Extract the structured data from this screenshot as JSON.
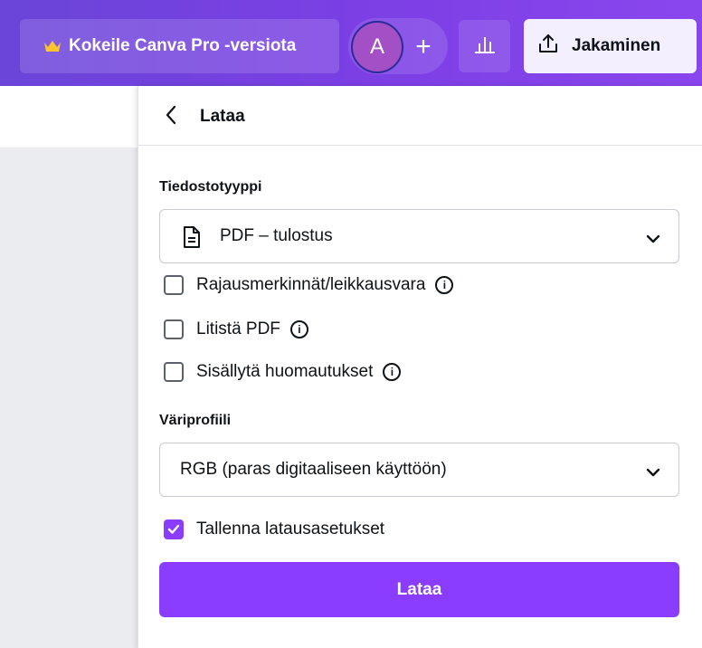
{
  "topbar": {
    "pro_label": "Kokeile Canva Pro -versiota",
    "avatar_initial": "A",
    "add_label": "+",
    "share_label": "Jakaminen"
  },
  "panel": {
    "title": "Lataa",
    "file_type_label": "Tiedostotyyppi",
    "file_type_value": "PDF – tulostus",
    "options": [
      {
        "label": "Rajausmerkinnät/leikkausvara",
        "checked": false
      },
      {
        "label": "Litistä PDF",
        "checked": false
      },
      {
        "label": "Sisällytä huomautukset",
        "checked": false
      }
    ],
    "color_profile_label": "Väriprofiili",
    "color_profile_value": "RGB (paras digitaaliseen käyttöön)",
    "save_settings_label": "Tallenna latausasetukset",
    "save_settings_checked": true,
    "download_button": "Lataa"
  },
  "icons": {
    "crown": "crown-icon",
    "stats": "bar-chart-icon",
    "share": "upload-icon",
    "back": "chevron-left-icon",
    "file": "document-icon",
    "chevron": "chevron-down-icon",
    "info": "info-icon",
    "check": "checkmark-icon"
  },
  "colors": {
    "brand_purple": "#8b3dff",
    "topbar_start": "#6a45d8",
    "topbar_end": "#8a46ee",
    "crown_gold": "#ffc42e",
    "avatar_bg": "#a34fc6"
  }
}
